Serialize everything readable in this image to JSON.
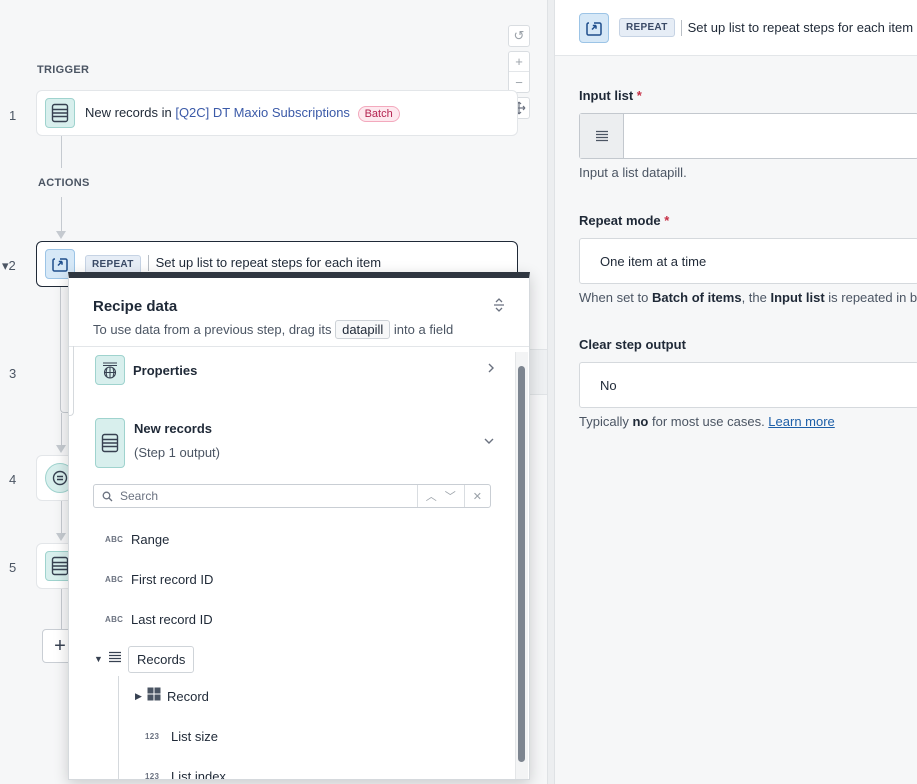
{
  "canvas": {
    "trigger_label": "TRIGGER",
    "actions_label": "ACTIONS",
    "step_numbers": [
      "1",
      "2",
      "3",
      "4",
      "5"
    ],
    "step1": {
      "prefix": "New records in",
      "link": "[Q2C] DT Maxio Subscriptions",
      "badge": "Batch"
    },
    "step2": {
      "badge": "REPEAT",
      "text": "Set up list to repeat steps for each item"
    },
    "zoom": {
      "reset": "↺",
      "zoom_in": "+",
      "zoom_out": "−",
      "fit": "⤧"
    },
    "add_step": "+"
  },
  "recipe_data": {
    "title": "Recipe data",
    "subtitle_before": "To use data from a previous step, drag its",
    "subtitle_pill": "datapill",
    "subtitle_after": "into a field",
    "properties_label": "Properties",
    "new_records": {
      "label": "New records",
      "sub": "(Step 1 output)"
    },
    "search_placeholder": "Search",
    "fields": [
      {
        "type": "ABC",
        "label": "Range"
      },
      {
        "type": "ABC",
        "label": "First record ID"
      },
      {
        "type": "ABC",
        "label": "Last record ID"
      }
    ],
    "records_label": "Records",
    "children": [
      {
        "type": "",
        "label": "Record"
      },
      {
        "type": "123",
        "label": "List size"
      },
      {
        "type": "123",
        "label": "List index"
      }
    ]
  },
  "panel": {
    "badge": "REPEAT",
    "title": "Set up list to repeat steps for each item",
    "input_list": {
      "label": "Input list",
      "required": "*",
      "hint": "Input a list datapill."
    },
    "repeat_mode": {
      "label": "Repeat mode",
      "required": "*",
      "value": "One item at a time",
      "hint_pre": "When set to ",
      "hint_b1": "Batch of items",
      "hint_mid": ", the ",
      "hint_b2": "Input list",
      "hint_post": " is repeated in ba"
    },
    "clear_output": {
      "label": "Clear step output",
      "value": "No",
      "hint_pre": "Typically ",
      "hint_b": "no",
      "hint_mid": " for most use cases. ",
      "hint_link": "Learn more"
    }
  },
  "colors": {
    "accent_teal": "#d8efed",
    "accent_blue": "#d6e8f7",
    "batch_badge": "#b42350",
    "link": "#1d5fa8",
    "required": "#c62f45"
  }
}
